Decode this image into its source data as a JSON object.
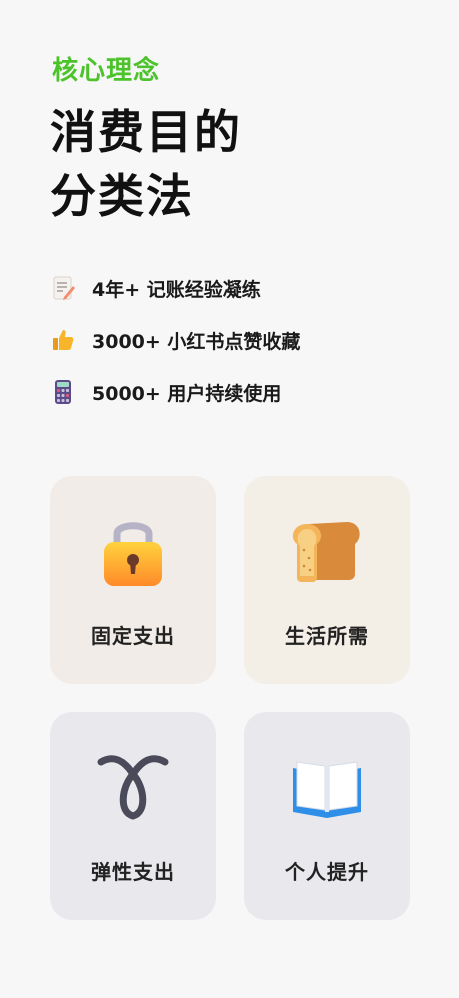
{
  "header": {
    "eyebrow": "核心理念",
    "title_line1": "消费目的",
    "title_line2": "分类法"
  },
  "features": [
    {
      "icon": "memo-icon",
      "text": "4年+ 记账经验凝练"
    },
    {
      "icon": "thumbs-up-icon",
      "text": "3000+ 小红书点赞收藏"
    },
    {
      "icon": "calculator-icon",
      "text": "5000+ 用户持续使用"
    }
  ],
  "cards": [
    {
      "icon": "lock-icon",
      "label": "固定支出"
    },
    {
      "icon": "bread-icon",
      "label": "生活所需"
    },
    {
      "icon": "loop-icon",
      "label": "弹性支出"
    },
    {
      "icon": "open-book-icon",
      "label": "个人提升"
    }
  ],
  "colors": {
    "accent": "#4cc32b",
    "background": "#f7f7f7",
    "card_warm": "#f1ece7",
    "card_cool": "#e9e9ed"
  }
}
